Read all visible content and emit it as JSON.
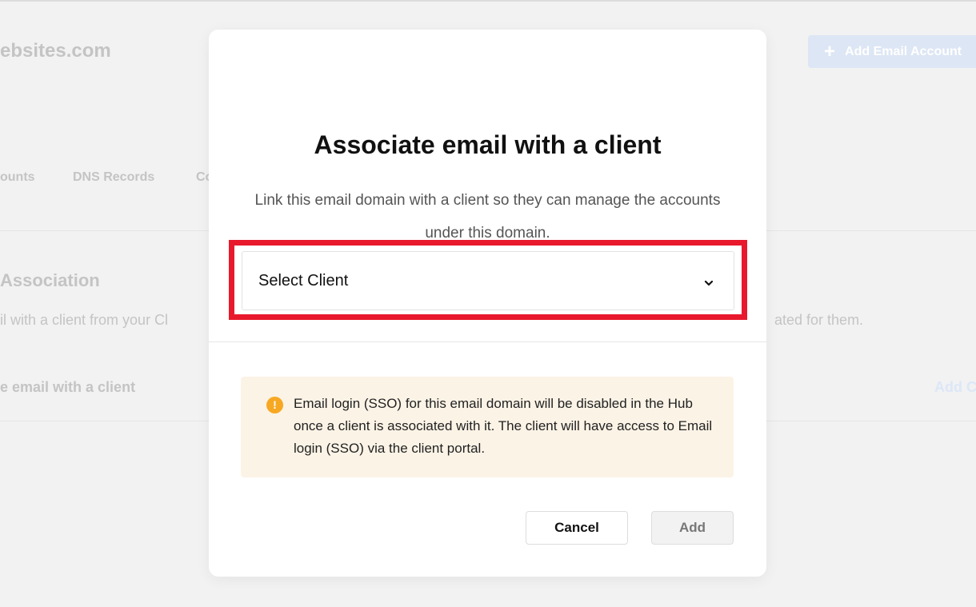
{
  "background": {
    "site_title": "ebsites.com",
    "add_account_label": "Add Email Account",
    "tabs": [
      "ounts",
      "DNS Records",
      "Co"
    ],
    "section_title": "Association",
    "section_desc_left": "il with a client from your Cl",
    "section_desc_right": "ated for them.",
    "row_label": "e email with a client",
    "row_link": "Add C"
  },
  "modal": {
    "title": "Associate email with a client",
    "description": "Link this email domain with a client so they can manage the accounts under this domain.",
    "select_placeholder": "Select Client",
    "notice": "Email login (SSO) for this email domain will be disabled in the Hub once a client is associated with it. The client will have access to Email login (SSO) via the client portal.",
    "warning_glyph": "!",
    "cancel_label": "Cancel",
    "add_label": "Add"
  },
  "colors": {
    "highlight": "#e8192c",
    "warning": "#f7a823",
    "notice_bg": "#fbf3e6"
  }
}
